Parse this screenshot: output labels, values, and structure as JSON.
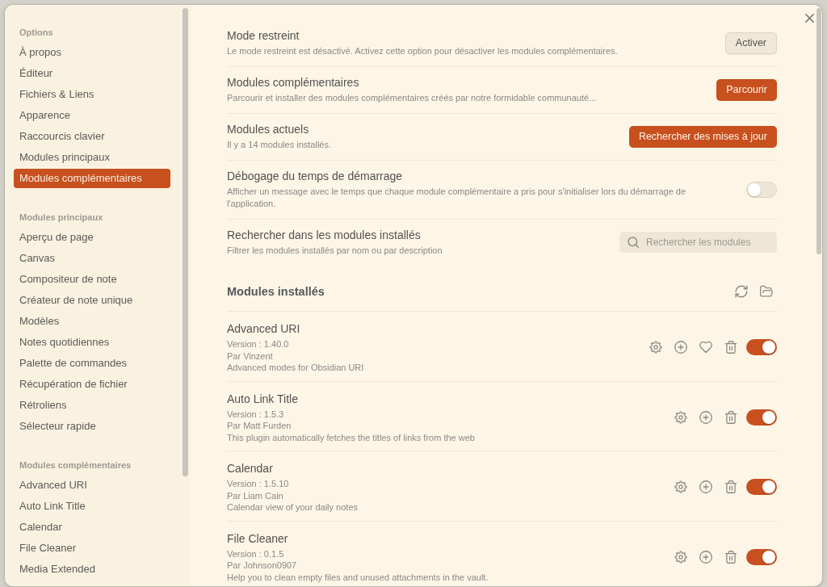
{
  "sidebar": {
    "sections": [
      {
        "heading": "Options",
        "items": [
          {
            "label": "À propos",
            "selected": false
          },
          {
            "label": "Éditeur",
            "selected": false
          },
          {
            "label": "Fichiers & Liens",
            "selected": false
          },
          {
            "label": "Apparence",
            "selected": false
          },
          {
            "label": "Raccourcis clavier",
            "selected": false
          },
          {
            "label": "Modules principaux",
            "selected": false
          },
          {
            "label": "Modules complémentaires",
            "selected": true
          }
        ]
      },
      {
        "heading": "Modules principaux",
        "items": [
          {
            "label": "Aperçu de page",
            "selected": false
          },
          {
            "label": "Canvas",
            "selected": false
          },
          {
            "label": "Compositeur de note",
            "selected": false
          },
          {
            "label": "Créateur de note unique",
            "selected": false
          },
          {
            "label": "Modèles",
            "selected": false
          },
          {
            "label": "Notes quotidiennes",
            "selected": false
          },
          {
            "label": "Palette de commandes",
            "selected": false
          },
          {
            "label": "Récupération de fichier",
            "selected": false
          },
          {
            "label": "Rétroliens",
            "selected": false
          },
          {
            "label": "Sélecteur rapide",
            "selected": false
          }
        ]
      },
      {
        "heading": "Modules complémentaires",
        "items": [
          {
            "label": "Advanced URI",
            "selected": false
          },
          {
            "label": "Auto Link Title",
            "selected": false
          },
          {
            "label": "Calendar",
            "selected": false
          },
          {
            "label": "File Cleaner",
            "selected": false
          },
          {
            "label": "Media Extended",
            "selected": false
          }
        ]
      }
    ]
  },
  "settings": [
    {
      "kind": "button",
      "title": "Mode restreint",
      "description": "Le mode restreint est désactivé. Activez cette option pour désactiver les modules complémentaires.",
      "button": "Activer"
    },
    {
      "kind": "cta",
      "title": "Modules complémentaires",
      "description": "Parcourir et installer des modules complémentaires créés par notre formidable communauté...",
      "button": "Parcourir"
    },
    {
      "kind": "cta",
      "title": "Modules actuels",
      "description": "Il y a 14 modules installés.",
      "button": "Rechercher des mises à jour"
    },
    {
      "kind": "toggle",
      "title": "Débogage du temps de démarrage",
      "description": "Afficher un message avec le temps que chaque module complémentaire a pris pour s'initialiser lors du démarrage de l'application.",
      "on": false
    },
    {
      "kind": "search",
      "title": "Rechercher dans les modules installés",
      "description": "Filtrer les modules installés par nom ou par description",
      "placeholder": "Rechercher les modules"
    }
  ],
  "installed": {
    "heading": "Modules installés",
    "plugins": [
      {
        "name": "Advanced URI",
        "version": "Version : 1.40.0",
        "author": "Par Vinzent",
        "description": "Advanced modes for Obsidian URI",
        "donate": true,
        "on": true
      },
      {
        "name": "Auto Link Title",
        "version": "Version : 1.5.3",
        "author": "Par Matt Furden",
        "description": "This plugin automatically fetches the titles of links from the web",
        "donate": false,
        "on": true
      },
      {
        "name": "Calendar",
        "version": "Version : 1.5.10",
        "author": "Par Liam Cain",
        "description": "Calendar view of your daily notes",
        "donate": false,
        "on": true
      },
      {
        "name": "File Cleaner",
        "version": "Version : 0.1.5",
        "author": "Par Johnson0907",
        "description": "Help you to clean empty files and unused attachments in the vault.",
        "donate": false,
        "on": true
      }
    ]
  }
}
